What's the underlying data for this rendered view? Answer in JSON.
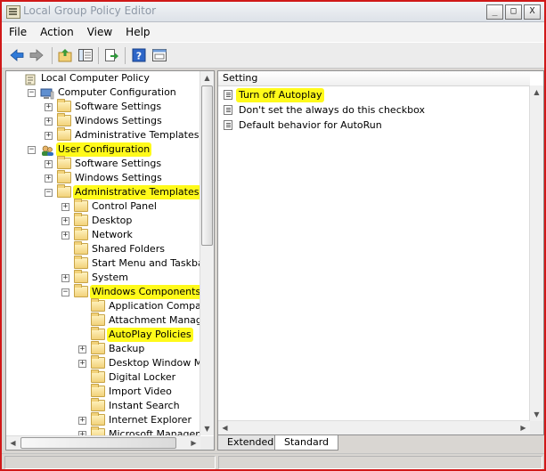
{
  "window": {
    "title": "Local Group Policy Editor"
  },
  "window_controls": {
    "minimize": "_",
    "restore": "□",
    "close": "X"
  },
  "menu": [
    {
      "label": "File"
    },
    {
      "label": "Action"
    },
    {
      "label": "View"
    },
    {
      "label": "Help"
    }
  ],
  "toolbar": {
    "buttons": [
      "back-arrow-icon",
      "forward-arrow-icon",
      "up-folder-icon",
      "show-tree-icon",
      "export-list-icon",
      "help-icon",
      "properties-icon"
    ]
  },
  "tree": {
    "items": [
      {
        "label": "Local Computer Policy",
        "level": 0,
        "expander": "",
        "icon": "computer-policy-icon",
        "highlight": false
      },
      {
        "label": "Computer Configuration",
        "level": 1,
        "expander": "−",
        "icon": "computer-icon",
        "highlight": false
      },
      {
        "label": "Software Settings",
        "level": 2,
        "expander": "+",
        "icon": "folder-icon",
        "highlight": false
      },
      {
        "label": "Windows Settings",
        "level": 2,
        "expander": "+",
        "icon": "folder-icon",
        "highlight": false
      },
      {
        "label": "Administrative Templates",
        "level": 2,
        "expander": "+",
        "icon": "folder-icon",
        "highlight": false
      },
      {
        "label": "User Configuration",
        "level": 1,
        "expander": "−",
        "icon": "users-icon",
        "highlight": true
      },
      {
        "label": "Software Settings",
        "level": 2,
        "expander": "+",
        "icon": "folder-icon",
        "highlight": false
      },
      {
        "label": "Windows Settings",
        "level": 2,
        "expander": "+",
        "icon": "folder-icon",
        "highlight": false
      },
      {
        "label": "Administrative Templates",
        "level": 2,
        "expander": "−",
        "icon": "folder-icon",
        "highlight": true
      },
      {
        "label": "Control Panel",
        "level": 3,
        "expander": "+",
        "icon": "folder-icon",
        "highlight": false
      },
      {
        "label": "Desktop",
        "level": 3,
        "expander": "+",
        "icon": "folder-icon",
        "highlight": false
      },
      {
        "label": "Network",
        "level": 3,
        "expander": "+",
        "icon": "folder-icon",
        "highlight": false
      },
      {
        "label": "Shared Folders",
        "level": 3,
        "expander": "",
        "icon": "folder-icon",
        "highlight": false
      },
      {
        "label": "Start Menu and Taskbar",
        "level": 3,
        "expander": "",
        "icon": "folder-icon",
        "highlight": false
      },
      {
        "label": "System",
        "level": 3,
        "expander": "+",
        "icon": "folder-icon",
        "highlight": false
      },
      {
        "label": "Windows Components",
        "level": 3,
        "expander": "−",
        "icon": "folder-icon",
        "highlight": true
      },
      {
        "label": "Application Compatibility",
        "level": 4,
        "expander": "",
        "icon": "folder-icon",
        "highlight": false
      },
      {
        "label": "Attachment Manager",
        "level": 4,
        "expander": "",
        "icon": "folder-icon",
        "highlight": false
      },
      {
        "label": "AutoPlay Policies",
        "level": 4,
        "expander": "",
        "icon": "folder-icon",
        "highlight": true
      },
      {
        "label": "Backup",
        "level": 4,
        "expander": "+",
        "icon": "folder-icon",
        "highlight": false
      },
      {
        "label": "Desktop Window Manag",
        "level": 4,
        "expander": "+",
        "icon": "folder-icon",
        "highlight": false
      },
      {
        "label": "Digital Locker",
        "level": 4,
        "expander": "",
        "icon": "folder-icon",
        "highlight": false
      },
      {
        "label": "Import Video",
        "level": 4,
        "expander": "",
        "icon": "folder-icon",
        "highlight": false
      },
      {
        "label": "Instant Search",
        "level": 4,
        "expander": "",
        "icon": "folder-icon",
        "highlight": false
      },
      {
        "label": "Internet Explorer",
        "level": 4,
        "expander": "+",
        "icon": "folder-icon",
        "highlight": false
      },
      {
        "label": "Microsoft Management C",
        "level": 4,
        "expander": "+",
        "icon": "folder-icon",
        "highlight": false
      }
    ]
  },
  "list": {
    "column_header": "Setting",
    "items": [
      {
        "label": "Turn off Autoplay",
        "icon": "setting-icon",
        "highlight": true
      },
      {
        "label": "Don't set the always do this checkbox",
        "icon": "setting-icon",
        "highlight": false
      },
      {
        "label": "Default behavior for AutoRun",
        "icon": "setting-icon",
        "highlight": false
      }
    ]
  },
  "tabs": [
    {
      "label": "Extended",
      "active": false
    },
    {
      "label": "Standard",
      "active": true
    }
  ],
  "colors": {
    "highlight": "#fffa1a",
    "window_border": "#d01818",
    "title_text": "#8e98a6"
  }
}
